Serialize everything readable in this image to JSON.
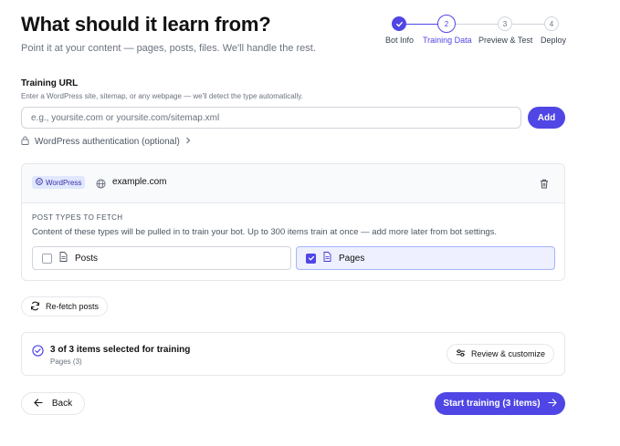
{
  "header": {
    "title": "What should it learn from?",
    "subtitle": "Point it at your content — pages, posts, files. We'll handle the rest."
  },
  "stepper": {
    "steps": [
      {
        "number": "",
        "label": "Bot Info",
        "state": "done"
      },
      {
        "number": "2",
        "label": "Training Data",
        "state": "active"
      },
      {
        "number": "3",
        "label": "Preview & Test",
        "state": "todo"
      },
      {
        "number": "4",
        "label": "Deploy",
        "state": "todo"
      }
    ]
  },
  "training_url": {
    "label": "Training URL",
    "hint": "Enter a WordPress site, sitemap, or any webpage — we'll detect the type automatically.",
    "placeholder": "e.g., yoursite.com or yoursite.com/sitemap.xml",
    "value": "",
    "add_label": "Add",
    "auth_label": "WordPress authentication (optional)"
  },
  "source": {
    "badge": "WordPress",
    "domain": "example.com",
    "post_types_title": "POST TYPES TO FETCH",
    "post_types_desc": "Content of these types will be pulled in to train your bot. Up to 300 items train at once — add more later from bot settings.",
    "options": [
      {
        "label": "Posts",
        "checked": false
      },
      {
        "label": "Pages",
        "checked": true
      }
    ]
  },
  "refetch_label": "Re-fetch posts",
  "summary": {
    "title": "3 of 3 items selected for training",
    "subtitle": "Pages (3)",
    "review_label": "Review & customize"
  },
  "footer": {
    "back_label": "Back",
    "start_label": "Start training (3 items)"
  },
  "colors": {
    "accent": "#4f46e5",
    "badge_bg": "#e0e7ff",
    "selected_bg": "#eef0ff"
  }
}
